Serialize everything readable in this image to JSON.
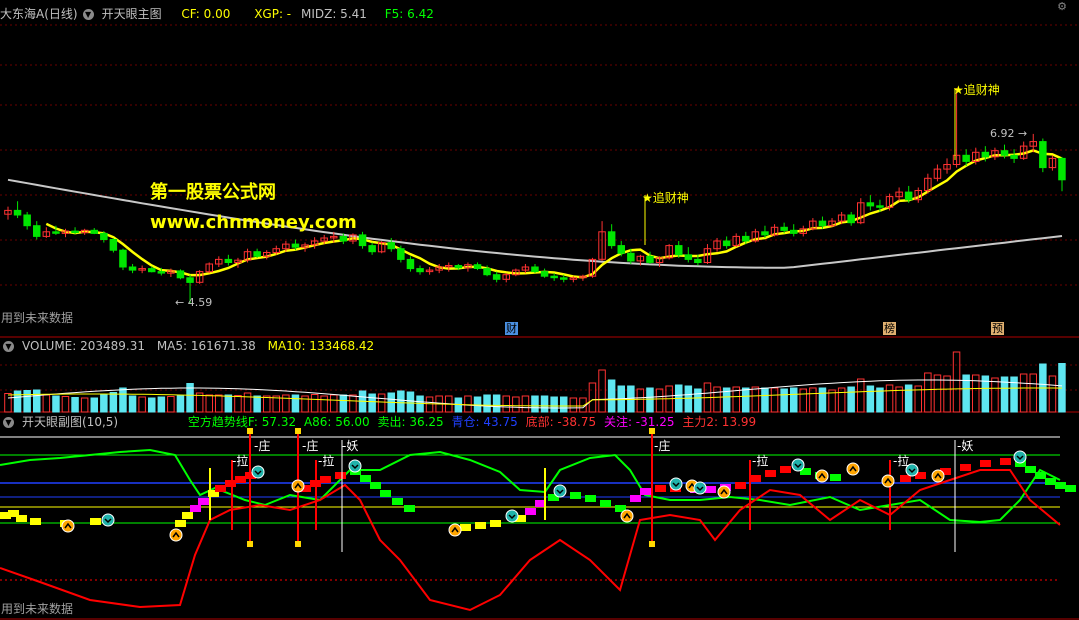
{
  "main_panel": {
    "stock_name": "大东海A(日线)",
    "indicator_name": "开天眼主图",
    "cf": "CF: 0.00",
    "xgp": "XGP: -",
    "midz": "MIDZ: 5.41",
    "f5": "F5: 6.42",
    "watermark_title": "第一股票公式网",
    "watermark_url": "www.chnmoney.com",
    "signal_label": "追财神",
    "low_price": "4.59",
    "high_price": "6.92",
    "future_data_note": "用到未来数据",
    "event_markers": [
      "财",
      "榜",
      "预"
    ]
  },
  "volume_panel": {
    "volume": "VOLUME: 203489.31",
    "ma5": "MA5: 161671.38",
    "ma10": "MA10: 133468.42"
  },
  "sub_panel": {
    "indicator_name": "开天眼副图(10,5)",
    "trend_line": "空方趋势线F: 57.32",
    "a86": "A86: 56.00",
    "sell": "卖出: 36.25",
    "position": "青仓: 43.75",
    "bottom": "底部: -38.75",
    "watch": "关注: -31.25",
    "main_force": "主力2: 13.99",
    "labels": [
      "庄",
      "拉",
      "庄",
      "拉",
      "妖",
      "庄",
      "拉",
      "拉",
      "妖"
    ],
    "future_data_note": "用到未来数据"
  },
  "colors": {
    "background": "#000000",
    "up_candle": "#ff3232",
    "down_candle": "#00e600",
    "volume_down": "#5ee6f0",
    "ma_yellow": "#ffff00",
    "ma_long": "#c8c8c8",
    "grid_red": "#8b0000",
    "sub_green": "#00ff00",
    "sub_red": "#ff0000",
    "sub_blue": "#2040ff"
  },
  "candles": [
    [
      5.75,
      5.85,
      5.68,
      5.8
    ],
    [
      5.8,
      5.92,
      5.7,
      5.74
    ],
    [
      5.74,
      5.78,
      5.55,
      5.6
    ],
    [
      5.6,
      5.66,
      5.42,
      5.46
    ],
    [
      5.46,
      5.58,
      5.44,
      5.52
    ],
    [
      5.52,
      5.6,
      5.48,
      5.5
    ],
    [
      5.5,
      5.56,
      5.45,
      5.53
    ],
    [
      5.53,
      5.58,
      5.49,
      5.51
    ],
    [
      5.51,
      5.56,
      5.48,
      5.54
    ],
    [
      5.54,
      5.57,
      5.49,
      5.5
    ],
    [
      5.5,
      5.53,
      5.38,
      5.42
    ],
    [
      5.42,
      5.44,
      5.25,
      5.28
    ],
    [
      5.28,
      5.3,
      5.02,
      5.06
    ],
    [
      5.06,
      5.1,
      4.98,
      5.02
    ],
    [
      5.02,
      5.08,
      4.98,
      5.04
    ],
    [
      5.04,
      5.07,
      4.99,
      5.0
    ],
    [
      5.0,
      5.05,
      4.95,
      4.98
    ],
    [
      4.98,
      5.04,
      4.93,
      5.01
    ],
    [
      5.01,
      5.03,
      4.9,
      4.92
    ],
    [
      4.92,
      4.96,
      4.59,
      4.86
    ],
    [
      4.86,
      5.02,
      4.84,
      5.0
    ],
    [
      5.0,
      5.12,
      4.98,
      5.1
    ],
    [
      5.1,
      5.2,
      5.06,
      5.16
    ],
    [
      5.16,
      5.22,
      5.08,
      5.12
    ],
    [
      5.12,
      5.18,
      5.05,
      5.15
    ],
    [
      5.15,
      5.3,
      5.12,
      5.26
    ],
    [
      5.26,
      5.3,
      5.18,
      5.2
    ],
    [
      5.2,
      5.28,
      5.16,
      5.25
    ],
    [
      5.25,
      5.34,
      5.22,
      5.3
    ],
    [
      5.3,
      5.4,
      5.26,
      5.36
    ],
    [
      5.36,
      5.42,
      5.28,
      5.32
    ],
    [
      5.32,
      5.38,
      5.26,
      5.35
    ],
    [
      5.35,
      5.45,
      5.3,
      5.4
    ],
    [
      5.4,
      5.48,
      5.36,
      5.44
    ],
    [
      5.44,
      5.52,
      5.38,
      5.46
    ],
    [
      5.46,
      5.5,
      5.36,
      5.4
    ],
    [
      5.4,
      5.5,
      5.36,
      5.48
    ],
    [
      5.48,
      5.52,
      5.3,
      5.34
    ],
    [
      5.34,
      5.38,
      5.22,
      5.26
    ],
    [
      5.26,
      5.4,
      5.24,
      5.38
    ],
    [
      5.38,
      5.44,
      5.26,
      5.3
    ],
    [
      5.3,
      5.34,
      5.12,
      5.16
    ],
    [
      5.16,
      5.2,
      5.0,
      5.04
    ],
    [
      5.04,
      5.08,
      4.96,
      5.0
    ],
    [
      5.0,
      5.06,
      4.96,
      5.02
    ],
    [
      5.02,
      5.1,
      4.98,
      5.06
    ],
    [
      5.06,
      5.12,
      5.0,
      5.08
    ],
    [
      5.08,
      5.1,
      5.02,
      5.05
    ],
    [
      5.05,
      5.12,
      5.0,
      5.09
    ],
    [
      5.09,
      5.12,
      5.02,
      5.04
    ],
    [
      5.04,
      5.08,
      4.94,
      4.96
    ],
    [
      4.96,
      5.0,
      4.86,
      4.9
    ],
    [
      4.9,
      4.98,
      4.86,
      4.96
    ],
    [
      4.96,
      5.04,
      4.94,
      5.02
    ],
    [
      5.02,
      5.1,
      4.98,
      5.06
    ],
    [
      5.06,
      5.1,
      4.98,
      5.0
    ],
    [
      5.0,
      5.04,
      4.92,
      4.94
    ],
    [
      4.94,
      4.98,
      4.88,
      4.92
    ],
    [
      4.92,
      4.96,
      4.86,
      4.9
    ],
    [
      4.9,
      4.94,
      4.86,
      4.92
    ],
    [
      4.92,
      4.96,
      4.88,
      4.94
    ],
    [
      4.94,
      5.18,
      4.92,
      5.16
    ],
    [
      5.16,
      5.66,
      5.14,
      5.52
    ],
    [
      5.52,
      5.62,
      5.3,
      5.34
    ],
    [
      5.34,
      5.4,
      5.2,
      5.24
    ],
    [
      5.24,
      5.3,
      5.1,
      5.14
    ],
    [
      5.14,
      5.22,
      5.08,
      5.2
    ],
    [
      5.2,
      5.26,
      5.1,
      5.12
    ],
    [
      5.12,
      5.2,
      5.06,
      5.18
    ],
    [
      5.18,
      5.36,
      5.16,
      5.34
    ],
    [
      5.34,
      5.4,
      5.18,
      5.22
    ],
    [
      5.22,
      5.32,
      5.12,
      5.16
    ],
    [
      5.16,
      5.22,
      5.08,
      5.12
    ],
    [
      5.12,
      5.36,
      5.1,
      5.3
    ],
    [
      5.3,
      5.44,
      5.26,
      5.4
    ],
    [
      5.4,
      5.46,
      5.3,
      5.34
    ],
    [
      5.34,
      5.5,
      5.32,
      5.46
    ],
    [
      5.46,
      5.52,
      5.36,
      5.4
    ],
    [
      5.4,
      5.56,
      5.38,
      5.52
    ],
    [
      5.52,
      5.6,
      5.44,
      5.48
    ],
    [
      5.48,
      5.62,
      5.46,
      5.58
    ],
    [
      5.58,
      5.64,
      5.5,
      5.54
    ],
    [
      5.54,
      5.62,
      5.46,
      5.5
    ],
    [
      5.5,
      5.6,
      5.46,
      5.56
    ],
    [
      5.56,
      5.7,
      5.54,
      5.66
    ],
    [
      5.66,
      5.72,
      5.56,
      5.6
    ],
    [
      5.6,
      5.7,
      5.58,
      5.66
    ],
    [
      5.66,
      5.78,
      5.62,
      5.74
    ],
    [
      5.74,
      5.78,
      5.6,
      5.64
    ],
    [
      5.64,
      5.96,
      5.62,
      5.9
    ],
    [
      5.9,
      6.0,
      5.8,
      5.86
    ],
    [
      5.86,
      5.94,
      5.78,
      5.84
    ],
    [
      5.84,
      6.02,
      5.8,
      5.98
    ],
    [
      5.98,
      6.1,
      5.92,
      6.04
    ],
    [
      6.04,
      6.12,
      5.9,
      5.94
    ],
    [
      5.94,
      6.1,
      5.9,
      6.06
    ],
    [
      6.06,
      6.28,
      6.02,
      6.22
    ],
    [
      6.22,
      6.4,
      6.18,
      6.34
    ],
    [
      6.34,
      6.48,
      6.28,
      6.4
    ],
    [
      6.4,
      7.4,
      6.36,
      6.52
    ],
    [
      6.52,
      6.6,
      6.38,
      6.44
    ],
    [
      6.44,
      6.62,
      6.4,
      6.56
    ],
    [
      6.56,
      6.64,
      6.44,
      6.5
    ],
    [
      6.5,
      6.62,
      6.46,
      6.58
    ],
    [
      6.58,
      6.66,
      6.48,
      6.52
    ],
    [
      6.52,
      6.6,
      6.42,
      6.48
    ],
    [
      6.48,
      6.7,
      6.46,
      6.64
    ],
    [
      6.64,
      6.8,
      6.56,
      6.7
    ],
    [
      6.7,
      6.74,
      6.3,
      6.36
    ],
    [
      6.36,
      6.52,
      6.32,
      6.48
    ],
    [
      6.48,
      6.5,
      6.05,
      6.2
    ]
  ]
}
